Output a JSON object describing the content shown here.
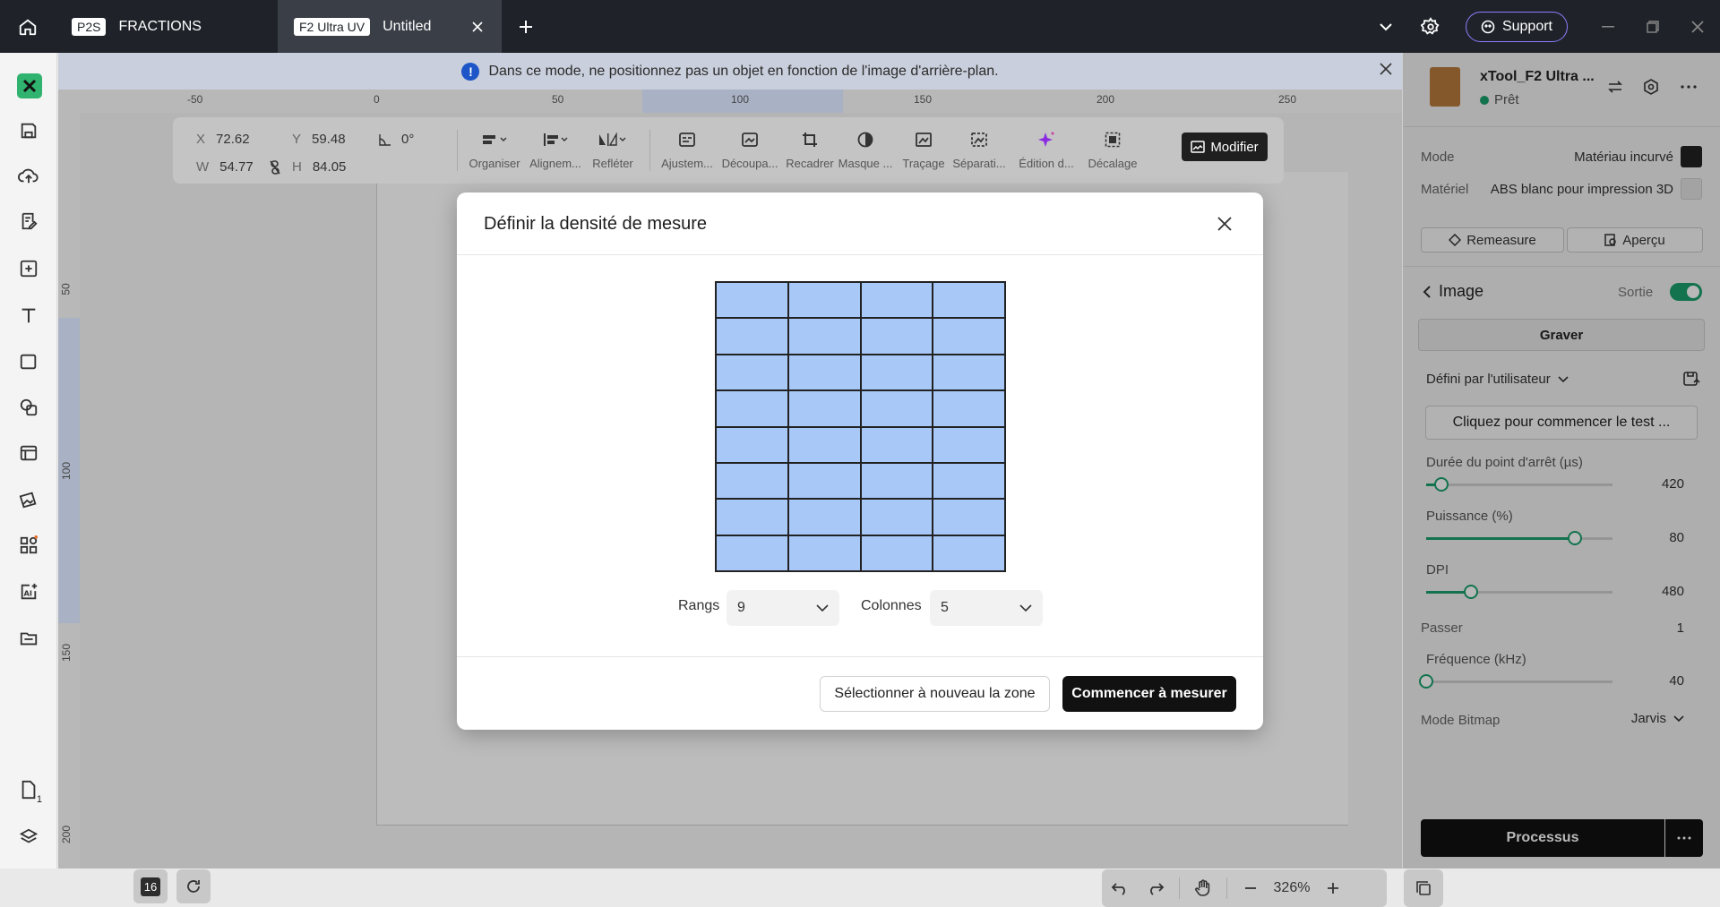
{
  "tabs": [
    {
      "badge": "P2S",
      "label": "FRACTIONS"
    },
    {
      "badge": "F2 Ultra UV",
      "label": "Untitled"
    }
  ],
  "topbar": {
    "support_label": "Support"
  },
  "info": {
    "message": "Dans ce mode, ne positionnez pas un objet en fonction de l'image d'arrière-plan.",
    "icon": "!"
  },
  "ruler": {
    "top": [
      "-50",
      "0",
      "50",
      "100",
      "150",
      "200",
      "250"
    ],
    "left": [
      "50",
      "100",
      "150",
      "200"
    ]
  },
  "coords": {
    "x_label": "X",
    "x": "72.62",
    "y_label": "Y",
    "y": "59.48",
    "w_label": "W",
    "w": "54.77",
    "h_label": "H",
    "h": "84.05",
    "angle": "0°"
  },
  "toolbar": {
    "items": [
      "Organiser",
      "Alignem...",
      "Refléter",
      "Ajustem...",
      "Découpa...",
      "Recadrer",
      "Masque ...",
      "Traçage",
      "Séparati...",
      "Édition d...",
      "Décalage"
    ],
    "modify_label": "Modifier"
  },
  "bottom": {
    "layer_count": "16",
    "zoom": "326%",
    "pages_count": "1"
  },
  "dialog": {
    "title": "Définir la densité de mesure",
    "rows_label": "Rangs",
    "rows_value": "9",
    "cols_label": "Colonnes",
    "cols_value": "5",
    "reselect_label": "Sélectionner à nouveau la zone",
    "start_label": "Commencer à mesurer"
  },
  "panel": {
    "device_name": "xTool_F2 Ultra ...",
    "device_status": "Prêt",
    "mode_label": "Mode",
    "mode_value": "Matériau incurvé",
    "material_label": "Matériel",
    "material_value": "ABS blanc pour impression 3D",
    "remeasure_label": "Remeasure",
    "preview_label": "Aperçu",
    "section_title": "Image",
    "output_label": "Sortie",
    "engrave_label": "Graver",
    "preset_label": "Défini par l'utilisateur",
    "test_label": "Cliquez pour commencer le test ...",
    "params": [
      {
        "label": "Durée du point d'arrêt",
        "unit": "(µs)",
        "value": "420",
        "fraction": 0.08
      },
      {
        "label": "Puissance (%)",
        "unit": "",
        "value": "80",
        "fraction": 0.8
      },
      {
        "label": "DPI",
        "unit": "",
        "value": "480",
        "fraction": 0.24
      }
    ],
    "pass_label": "Passer",
    "pass_value": "1",
    "freq_label": "Fréquence (kHz)",
    "freq_value": "40",
    "freq_fraction": 0.0,
    "bitmap_label": "Mode Bitmap",
    "bitmap_value": "Jarvis",
    "process_label": "Processus"
  },
  "colors": {
    "accent": "#1aa06d",
    "grid_fill": "#a8c8f8",
    "info_icon": "#1e56c8",
    "support_border": "#8b7dff"
  }
}
